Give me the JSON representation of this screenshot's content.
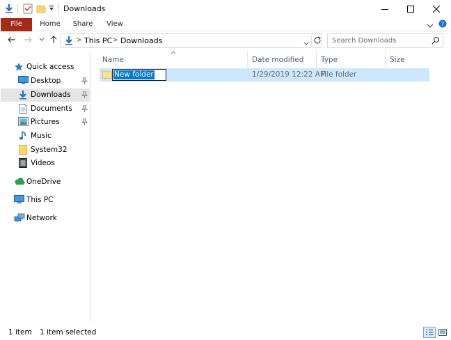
{
  "window": {
    "title": "Downloads",
    "minimize_glyph": "—",
    "maximize_glyph": "☐",
    "close_glyph": "✕"
  },
  "ribbon": {
    "tabs": [
      "File",
      "Home",
      "Share",
      "View"
    ],
    "accent_color": "#a52a17"
  },
  "address": {
    "crumbs": [
      "This PC",
      "Downloads"
    ],
    "separator": ">"
  },
  "search": {
    "placeholder": "Search Downloads"
  },
  "navpane": {
    "quick_access": "Quick access",
    "items": [
      {
        "label": "Desktop",
        "icon": "desktop-icon",
        "pinned": true
      },
      {
        "label": "Downloads",
        "icon": "downloads-icon",
        "pinned": true,
        "selected": true
      },
      {
        "label": "Documents",
        "icon": "documents-icon",
        "pinned": true
      },
      {
        "label": "Pictures",
        "icon": "pictures-icon",
        "pinned": true
      },
      {
        "label": "Music",
        "icon": "music-icon",
        "pinned": false
      },
      {
        "label": "System32",
        "icon": "folder-icon",
        "pinned": false
      },
      {
        "label": "Videos",
        "icon": "videos-icon",
        "pinned": false
      }
    ],
    "onedrive": "OneDrive",
    "thispc": "This PC",
    "network": "Network"
  },
  "columns": {
    "name": "Name",
    "date": "Date modified",
    "type": "Type",
    "size": "Size"
  },
  "files": [
    {
      "name": "New folder",
      "date": "1/29/2019 12:22 AM",
      "type": "File folder",
      "size": "",
      "selected": true,
      "renaming": true
    }
  ],
  "status": {
    "count": "1 item",
    "selected": "1 item selected"
  }
}
